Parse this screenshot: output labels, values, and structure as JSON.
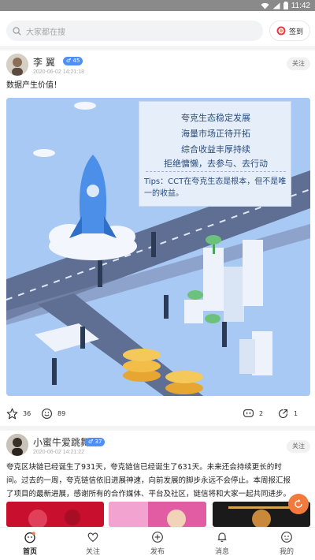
{
  "status": {
    "time": "11:42"
  },
  "search": {
    "placeholder": "大家都在搜",
    "sign_label": "签到"
  },
  "posts": [
    {
      "user": "李 翼",
      "level": "45",
      "time": "2020-06-02 14:21:18",
      "follow": "关注",
      "text": "数据产生价值！",
      "image": {
        "lines": [
          "夸克生态稳定发展",
          "海量市场正待开拓",
          "综合收益丰厚持续",
          "拒绝慵懒，去参与、去行动"
        ],
        "tips": "Tips：CCT在夸克生态是根本，但不是唯一的收益。"
      },
      "likes": "36",
      "views": "89",
      "comments": "2",
      "shares": "1"
    },
    {
      "user": "小蜜牛爱跳舞",
      "level": "37",
      "time": "2020-06-02 14:21:22",
      "follow": "关注",
      "text_lines": [
        "夸克区块链已经诞生了931天，夸克链信已经诞生了631天。未来还会持续更长的时",
        "间。过去的一周，夸克链信依旧进展神速，向前发展的脚步永远不会停止。本周报汇报",
        "了项目的最新进展，感谢所有的合作媒体、平台及社区，链信将和大家一起共同进步。"
      ]
    }
  ],
  "tabs": [
    {
      "label": "首页",
      "icon": "home-icon"
    },
    {
      "label": "关注",
      "icon": "heart-icon"
    },
    {
      "label": "发布",
      "icon": "plus-icon"
    },
    {
      "label": "消息",
      "icon": "bell-icon"
    },
    {
      "label": "我的",
      "icon": "face-icon"
    }
  ],
  "colors": {
    "accent": "#f37a3c",
    "badge": "#4f8ff7",
    "sign_ring": "#e8344e"
  }
}
